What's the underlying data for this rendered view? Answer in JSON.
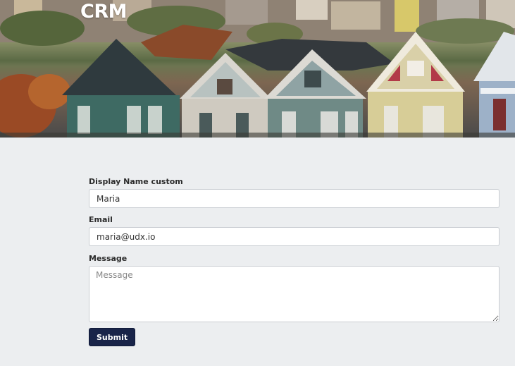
{
  "header": {
    "title": "CRM"
  },
  "form": {
    "name": {
      "label": "Display Name custom",
      "value": "Maria"
    },
    "email": {
      "label": "Email",
      "value": "maria@udx.io"
    },
    "message": {
      "label": "Message",
      "placeholder": "Message",
      "value": ""
    },
    "submit_label": "Submit"
  },
  "colors": {
    "page_background": "#eceef0",
    "button_background": "#192449",
    "button_text": "#ffffff"
  }
}
